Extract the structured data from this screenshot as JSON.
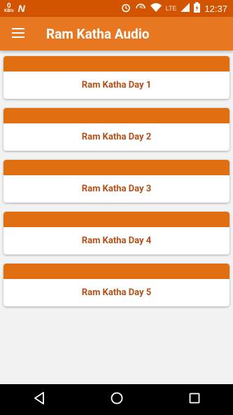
{
  "status_bar": {
    "net_speed_value": "0",
    "net_speed_unit": "KB/s",
    "network_label": "LTE",
    "time": "12:37",
    "icons": [
      "alarm-icon",
      "signal-4g-icon",
      "wifi-icon",
      "signal-bars-icon",
      "battery-charging-icon"
    ]
  },
  "app_bar": {
    "title": "Ram Katha Audio",
    "menu_icon": "hamburger-menu-icon"
  },
  "list": {
    "items": [
      {
        "label": "Ram Katha Day 1"
      },
      {
        "label": "Ram Katha Day 2"
      },
      {
        "label": "Ram Katha Day 3"
      },
      {
        "label": "Ram Katha Day 4"
      },
      {
        "label": "Ram Katha Day 5"
      }
    ]
  },
  "colors": {
    "status_bar": "#d35400",
    "app_bar": "#e87722",
    "card_header": "#e06f12",
    "card_text": "#b34e16",
    "background": "#f2f2f2",
    "nav_bar": "#000000"
  },
  "nav_bar": {
    "icons": [
      "back-triangle-icon",
      "home-circle-icon",
      "recents-square-icon"
    ]
  }
}
